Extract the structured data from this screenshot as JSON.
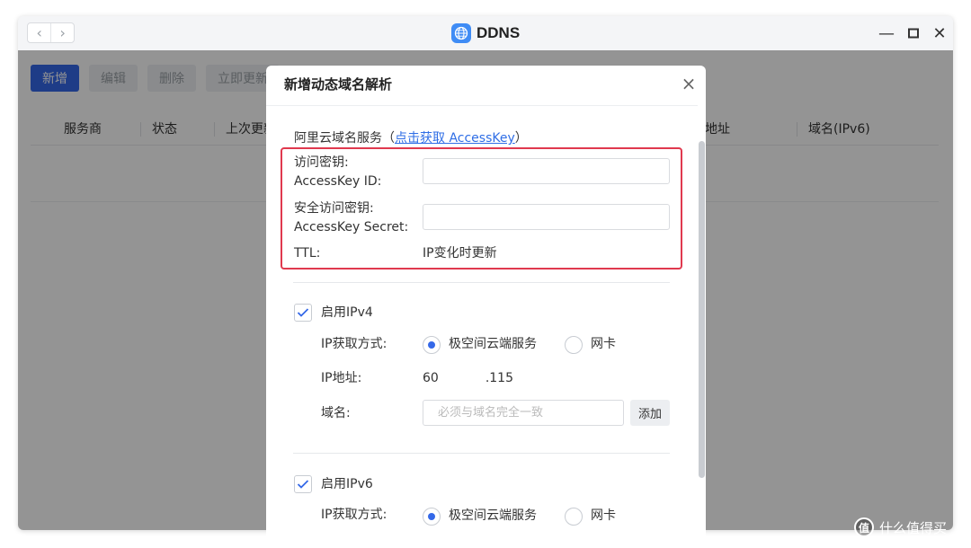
{
  "window": {
    "title": "DDNS",
    "nav": {
      "back": "‹",
      "forward": "›"
    },
    "controls": {
      "minimize": "—",
      "maximize": "□",
      "close": "✕"
    }
  },
  "toolbar": {
    "add_label": "新增",
    "edit_label": "编辑",
    "delete_label": "删除",
    "update_now_label": "立即更新"
  },
  "table": {
    "columns": [
      "服务商",
      "状态",
      "上次更新",
      "地址",
      "域名(IPv6)"
    ]
  },
  "dialog": {
    "title": "新增动态域名解析",
    "close": "×",
    "provider_label": "阿里云域名服务（",
    "provider_link": "点击获取 AccessKey",
    "provider_suffix": "）",
    "key_id_label_line1": "访问密钥:",
    "key_id_label_line2": "AccessKey ID:",
    "key_id_value": "",
    "key_secret_label_line1": "安全访问密钥:",
    "key_secret_label_line2": "AccessKey Secret:",
    "key_secret_value": "",
    "ttl_label": "TTL:",
    "ttl_value": "IP变化时更新",
    "ipv4": {
      "enable_label": "启用IPv4",
      "checked": true,
      "method_label": "IP获取方式:",
      "option_cloud": "极空间云端服务",
      "option_nic": "网卡",
      "selected": "极空间云端服务",
      "ip_label": "IP地址:",
      "ip_prefix": "60",
      "ip_suffix": ".115",
      "domain_label": "域名:",
      "domain_placeholder": "必须与域名完全一致",
      "add_label": "添加"
    },
    "ipv6": {
      "enable_label": "启用IPv6",
      "checked": true,
      "method_label": "IP获取方式:",
      "option_cloud": "极空间云端服务",
      "option_nic": "网卡",
      "selected": "极空间云端服务"
    }
  },
  "watermark": {
    "logo": "值",
    "text": "什么值得买"
  },
  "colors": {
    "primary": "#3468e8",
    "highlight": "#e0394e",
    "link": "#2f6ee6"
  }
}
